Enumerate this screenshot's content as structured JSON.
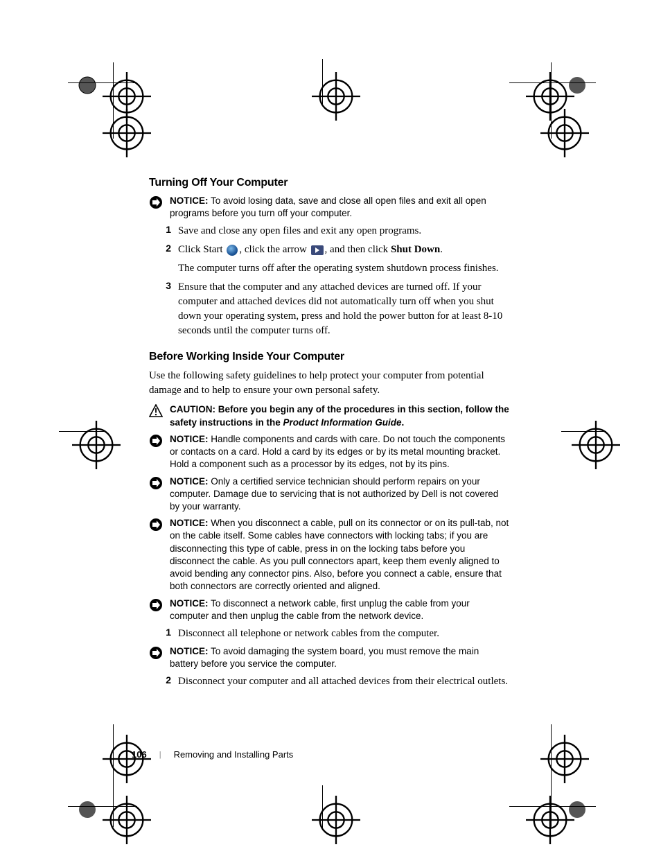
{
  "sections": {
    "s1": {
      "heading": "Turning Off Your Computer",
      "notice1_label": "NOTICE:",
      "notice1_text": " To avoid losing data, save and close all open files and exit all open programs before you turn off your computer.",
      "step1_num": "1",
      "step1_text": "Save and close any open files and exit any open programs.",
      "step2_num": "2",
      "step2_pre": "Click Start ",
      "step2_mid": ", click the arrow ",
      "step2_post": ", and then click ",
      "step2_bold": "Shut Down",
      "step2_end": ".",
      "step2_sub": "The computer turns off after the operating system shutdown process finishes.",
      "step3_num": "3",
      "step3_text": "Ensure that the computer and any attached devices are turned off. If your computer and attached devices did not automatically turn off when you shut down your operating system, press and hold the power button for at least 8-10 seconds until the computer turns off."
    },
    "s2": {
      "heading": "Before Working Inside Your Computer",
      "intro": "Use the following safety guidelines to help protect your computer from potential damage and to help to ensure your own personal safety.",
      "caution_label": "CAUTION:",
      "caution_pre": " Before you begin any of the procedures in this section, follow the safety instructions in the ",
      "caution_ref": "Product Information Guide",
      "caution_post": ".",
      "notice2_label": "NOTICE:",
      "notice2_text": " Handle components and cards with care. Do not touch the components or contacts on a card. Hold a card by its edges or by its metal mounting bracket. Hold a component such as a processor by its edges, not by its pins.",
      "notice3_label": "NOTICE:",
      "notice3_text": " Only a certified service technician should perform repairs on your computer. Damage due to servicing that is not authorized by Dell is not covered by your warranty.",
      "notice4_label": "NOTICE:",
      "notice4_text": " When you disconnect a cable, pull on its connector or on its pull-tab, not on the cable itself. Some cables have connectors with locking tabs; if you are disconnecting this type of cable, press in on the locking tabs before you disconnect the cable. As you pull connectors apart, keep them evenly aligned to avoid bending any connector pins. Also, before you connect a cable, ensure that both connectors are correctly oriented and aligned.",
      "notice5_label": "NOTICE:",
      "notice5_text": " To disconnect a network cable, first unplug the cable from your computer and then unplug the cable from the network device.",
      "step1_num": "1",
      "step1_text": "Disconnect all telephone or network cables from the computer.",
      "notice6_label": "NOTICE:",
      "notice6_text": " To avoid damaging the system board, you must remove the main battery before you service the computer.",
      "step2_num": "2",
      "step2_text": "Disconnect your computer and all attached devices from their electrical outlets."
    }
  },
  "footer": {
    "page": "106",
    "chapter": "Removing and Installing Parts"
  }
}
